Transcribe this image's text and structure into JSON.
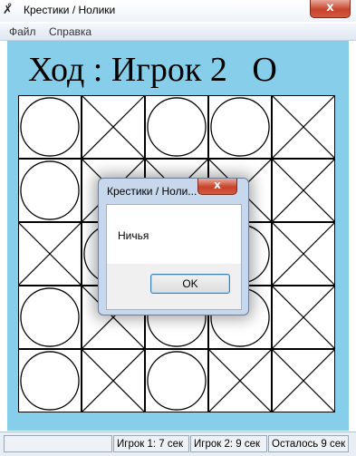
{
  "window": {
    "title": "Крестики / Нолики",
    "icon": "x-o-app-icon",
    "close_glyph": "x"
  },
  "menu": {
    "items": [
      {
        "label": "Файл"
      },
      {
        "label": "Справка"
      }
    ]
  },
  "game": {
    "turn_prefix": "Ход :",
    "player_label": "Игрок 2",
    "player_symbol": "O",
    "area_color": "#87ceea",
    "board": [
      [
        "O",
        "X",
        "O",
        "O",
        "X"
      ],
      [
        "O",
        "X",
        "X",
        "X",
        "X"
      ],
      [
        "X",
        "O",
        "X",
        "O",
        "X"
      ],
      [
        "O",
        "X",
        "O",
        "O",
        "X"
      ],
      [
        "O",
        "X",
        "O",
        "X",
        "X"
      ]
    ]
  },
  "status": {
    "player1": "Игрок 1: 7 сек",
    "player2": "Игрок 2: 9 сек",
    "remaining": "Осталось 9 сек"
  },
  "dialog": {
    "title": "Крестики / Ноли...",
    "message": "Ничья",
    "ok_label": "OK",
    "close_glyph": "x"
  }
}
